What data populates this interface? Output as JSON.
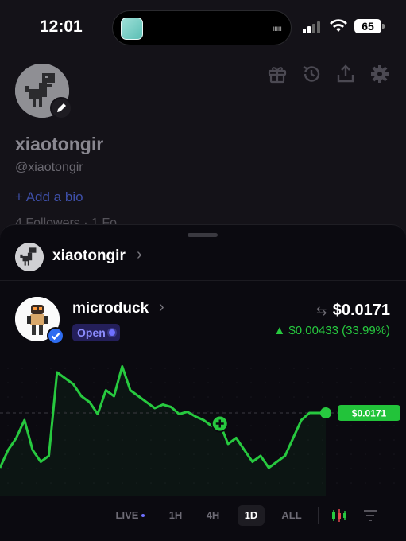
{
  "status_bar": {
    "time": "12:01",
    "battery": "65",
    "island_dots": "ıııııı"
  },
  "profile": {
    "username": "xiaotongir",
    "handle": "@xiaotongir",
    "add_bio": "+ Add a bio",
    "followers_peek": "4 Followers · 1 Fo",
    "icons": [
      "gift-icon",
      "history-icon",
      "share-icon",
      "settings-icon"
    ]
  },
  "sheet": {
    "owner": {
      "name": "xiaotongir",
      "chevron": "›"
    },
    "token": {
      "name": "microduck",
      "chevron": "›",
      "status": "Open",
      "price": "$0.0171",
      "change": "▲ $0.00433 (33.99%)"
    },
    "chart_data": {
      "type": "line",
      "title": "",
      "x": [
        0,
        1,
        2,
        3,
        4,
        5,
        6,
        7,
        8,
        9,
        10,
        11,
        12,
        13,
        14,
        15,
        16,
        17,
        18,
        19,
        20,
        21,
        22,
        23,
        24,
        25,
        26,
        27,
        28,
        29,
        30,
        31,
        32,
        33,
        34,
        35,
        36,
        37,
        38,
        39,
        40
      ],
      "values": [
        0.0125,
        0.014,
        0.015,
        0.0165,
        0.014,
        0.013,
        0.0135,
        0.0205,
        0.02,
        0.0195,
        0.0185,
        0.018,
        0.017,
        0.019,
        0.0185,
        0.021,
        0.019,
        0.0185,
        0.018,
        0.0175,
        0.0178,
        0.0176,
        0.017,
        0.0172,
        0.0168,
        0.0165,
        0.016,
        0.0162,
        0.0145,
        0.015,
        0.014,
        0.013,
        0.0135,
        0.0125,
        0.013,
        0.0135,
        0.015,
        0.0165,
        0.0171,
        0.0171,
        0.0171
      ],
      "current_label": "$0.0171",
      "marker_index": 27,
      "line_color": "#27c93f",
      "grid": "dotted"
    },
    "timeframes": [
      {
        "label": "LIVE",
        "active": false
      },
      {
        "label": "1H",
        "active": false
      },
      {
        "label": "4H",
        "active": false
      },
      {
        "label": "1D",
        "active": true
      },
      {
        "label": "ALL",
        "active": false
      }
    ]
  },
  "colors": {
    "accent_green": "#27c93f",
    "open_purple": "#8c8cff",
    "bio_blue": "#3e4fa8"
  }
}
